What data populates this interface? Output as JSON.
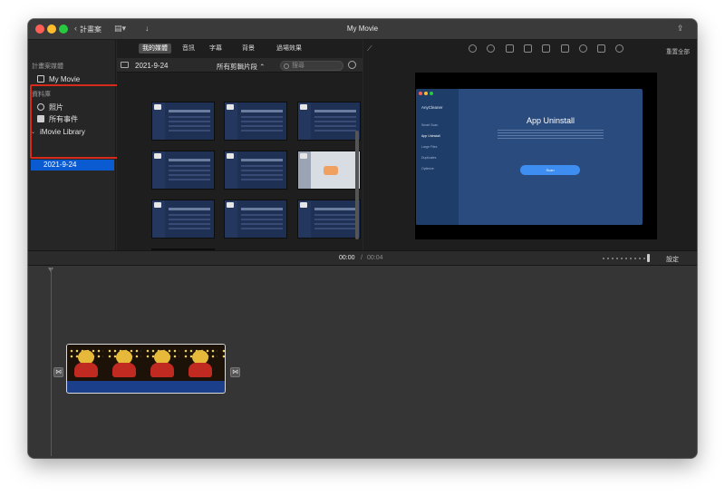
{
  "window": {
    "title": "My Movie",
    "back_label": "計畫案"
  },
  "sidebar": {
    "projects_header": "計畫案媒體",
    "project_item": "My Movie",
    "library_header": "資料庫",
    "items": [
      {
        "label": "照片",
        "icon": "flower-icon"
      },
      {
        "label": "所有事件",
        "icon": "star-icon"
      }
    ],
    "library_name": "iMovie Library",
    "event_selected": "2021-9-24"
  },
  "browser": {
    "tabs": [
      "我的媒體",
      "音訊",
      "字幕",
      "背景",
      "過場效果"
    ],
    "active_tab": "我的媒體",
    "date": "2021-9-24",
    "filter": "所有剪輯片段",
    "search_placeholder": "搜尋"
  },
  "viewer": {
    "reset_label": "重置全部",
    "app_title": "App Uninstall",
    "app_logo": "AnyCleaner",
    "app_button": "Scan",
    "app_nav": [
      "Smart Scan",
      "App Uninstall",
      "Large Files",
      "Duplicates",
      "Optimize"
    ]
  },
  "timeline": {
    "current_time": "00:00",
    "separator": "/",
    "total_time": "00:04",
    "settings_label": "設定"
  },
  "colors": {
    "selection": "#0a5bd1",
    "highlight_box": "#d62a1a",
    "app_bg": "#2a4b7d",
    "app_button": "#3d8ef0"
  }
}
